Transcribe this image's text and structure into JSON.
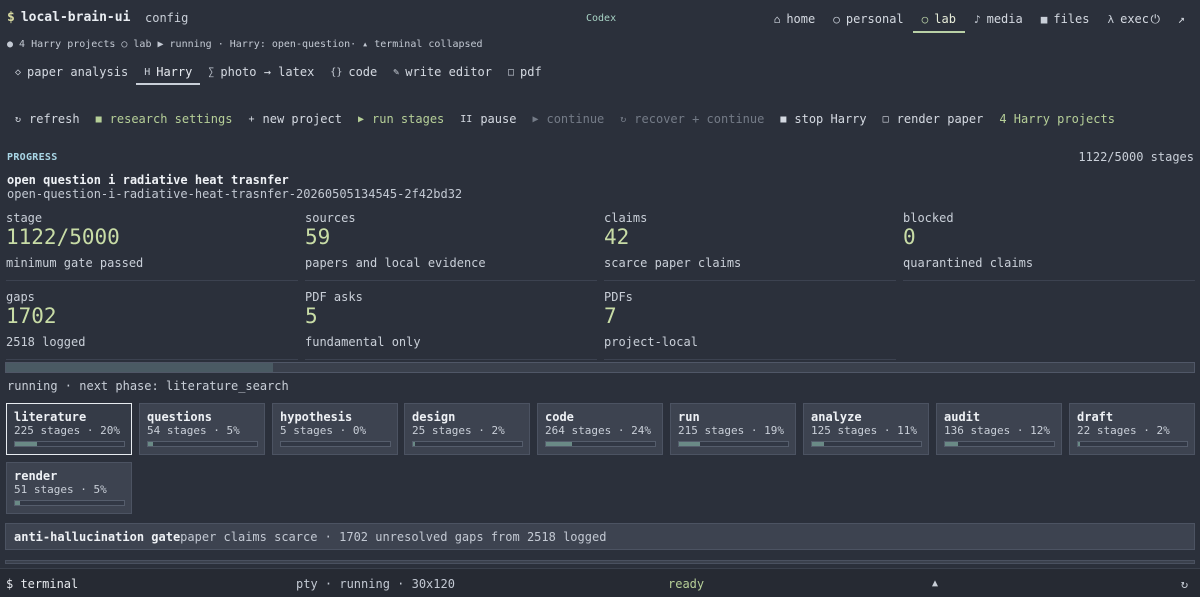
{
  "app": {
    "dollar": "$",
    "title": "local-brain-ui",
    "config_label": "config",
    "center_label": "Codex"
  },
  "nav": [
    {
      "icon": "⌂",
      "label": "home"
    },
    {
      "icon": "○",
      "label": "personal"
    },
    {
      "icon": "○",
      "label": "lab"
    },
    {
      "icon": "♪",
      "label": "media"
    },
    {
      "icon": "■",
      "label": "files"
    },
    {
      "icon": "λ",
      "label": "exec"
    }
  ],
  "nav_icons": {
    "power": "⏻",
    "expand": "↗"
  },
  "statusline": [
    "● 4 Harry projects",
    "○ lab",
    "▶ running ·",
    "Harry: open-question·",
    "▴ terminal collapsed"
  ],
  "subtabs": [
    {
      "icon": "◇",
      "label": "paper analysis"
    },
    {
      "icon": "H",
      "label": "Harry"
    },
    {
      "icon": "∑",
      "label": "photo → latex"
    },
    {
      "icon": "{}",
      "label": "code"
    },
    {
      "icon": "✎",
      "label": "write editor"
    },
    {
      "icon": "□",
      "label": "pdf"
    }
  ],
  "toolbar": [
    {
      "icon": "↻",
      "label": "refresh"
    },
    {
      "icon": "■",
      "label": "research settings"
    },
    {
      "icon": "+",
      "label": "new project"
    },
    {
      "icon": "▶",
      "label": "run stages"
    },
    {
      "icon": "II",
      "label": "pause"
    },
    {
      "icon": "▶",
      "label": "continue"
    },
    {
      "icon": "↻",
      "label": "recover + continue"
    },
    {
      "icon": "■",
      "label": "stop Harry"
    },
    {
      "icon": "□",
      "label": "render paper"
    }
  ],
  "toolbar_count": "4 Harry projects",
  "progress": {
    "label": "PROGRESS",
    "count": "1122/5000 stages",
    "fraction": 0.2244
  },
  "project": {
    "title": "open question i radiative heat trasnfer",
    "slug": "open-question-i-radiative-heat-trasnfer-20260505134545-2f42bd32"
  },
  "stats": [
    {
      "label": "stage",
      "value": "1122/5000",
      "sub": "minimum gate passed"
    },
    {
      "label": "sources",
      "value": "59",
      "sub": "papers and local evidence"
    },
    {
      "label": "claims",
      "value": "42",
      "sub": "scarce paper claims"
    },
    {
      "label": "blocked",
      "value": "0",
      "sub": "quarantined claims"
    },
    {
      "label": "gaps",
      "value": "1702",
      "sub": "2518 logged"
    },
    {
      "label": "PDF asks",
      "value": "5",
      "sub": "fundamental only"
    },
    {
      "label": "PDFs",
      "value": "7",
      "sub": "project-local"
    }
  ],
  "phase_line": "running · next phase: literature_search",
  "stages": [
    {
      "name": "literature",
      "meta": "225 stages · 20%",
      "pct": 0.2
    },
    {
      "name": "questions",
      "meta": "54 stages · 5%",
      "pct": 0.05
    },
    {
      "name": "hypothesis",
      "meta": "5 stages · 0%",
      "pct": 0.0
    },
    {
      "name": "design",
      "meta": "25 stages · 2%",
      "pct": 0.02
    },
    {
      "name": "code",
      "meta": "264 stages · 24%",
      "pct": 0.24
    },
    {
      "name": "run",
      "meta": "215 stages · 19%",
      "pct": 0.19
    },
    {
      "name": "analyze",
      "meta": "125 stages · 11%",
      "pct": 0.11
    },
    {
      "name": "audit",
      "meta": "136 stages · 12%",
      "pct": 0.12
    },
    {
      "name": "draft",
      "meta": "22 stages · 2%",
      "pct": 0.02
    },
    {
      "name": "render",
      "meta": "51 stages · 5%",
      "pct": 0.05
    }
  ],
  "gate": {
    "title": "anti-hallucination gate",
    "text": "paper claims scarce · 1702 unresolved gaps from 2518 logged"
  },
  "terminal": {
    "label": "$ terminal",
    "status": "pty · running · 30x120",
    "ready": "ready",
    "up_icon": "▲",
    "refresh_icon": "↻"
  }
}
